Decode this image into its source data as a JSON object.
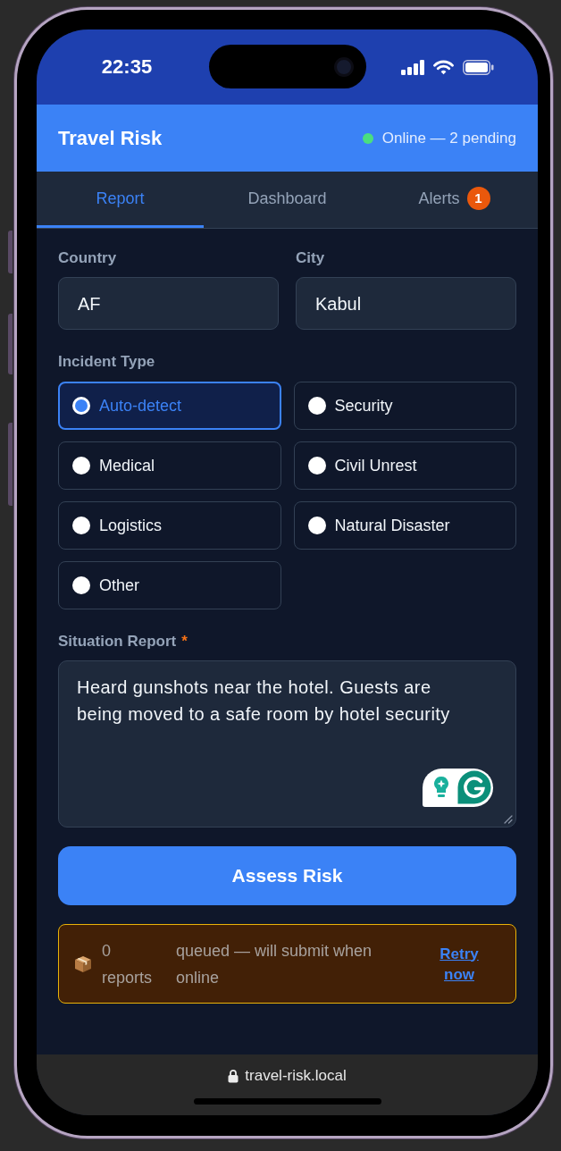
{
  "status_bar": {
    "time": "22:35"
  },
  "header": {
    "title": "Travel Risk",
    "connection": {
      "online": true,
      "label": "Online — 2 pending"
    }
  },
  "tabs": [
    {
      "label": "Report",
      "selected": true
    },
    {
      "label": "Dashboard",
      "selected": false
    },
    {
      "label": "Alerts",
      "selected": false,
      "badge": "1"
    }
  ],
  "form": {
    "location_fields": [
      {
        "label": "Country",
        "value": "AF"
      },
      {
        "label": "City",
        "value": "Kabul"
      }
    ],
    "incident_type": {
      "label": "Incident Type",
      "options": [
        {
          "label": "Auto-detect",
          "selected": true
        },
        {
          "label": "Security",
          "selected": false
        },
        {
          "label": "Medical",
          "selected": false
        },
        {
          "label": "Civil Unrest",
          "selected": false
        },
        {
          "label": "Logistics",
          "selected": false
        },
        {
          "label": "Natural Disaster",
          "selected": false
        },
        {
          "label": "Other",
          "selected": false
        }
      ]
    },
    "situation_report": {
      "label": "Situation Report",
      "required_mark": "*",
      "value": "Heard gunshots near the hotel. Guests are being moved to a safe room by hotel security"
    },
    "submit_button": {
      "label": "Assess Risk"
    }
  },
  "queue_banner": {
    "count": "0 reports",
    "message": "queued — will submit when online",
    "action": "Retry now"
  },
  "browser_bar": {
    "url": "travel-risk.local"
  }
}
